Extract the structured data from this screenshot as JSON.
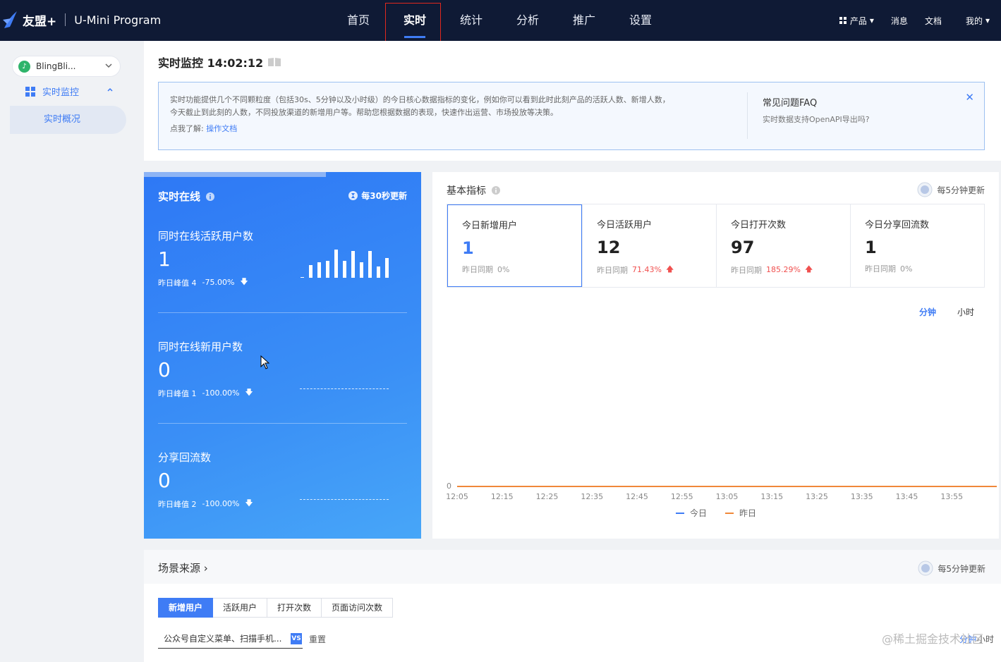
{
  "header": {
    "brand": "友盟+",
    "product": "U-Mini Program",
    "nav": [
      "首页",
      "实时",
      "统计",
      "分析",
      "推广",
      "设置"
    ],
    "active_nav": "实时",
    "right_products": "产品",
    "right_messages": "消息",
    "right_docs": "文档",
    "right_mine": "我的"
  },
  "sidebar": {
    "app_name": "BlingBli...",
    "menu_group": "实时监控",
    "menu_item": "实时概况"
  },
  "page": {
    "title": "实时监控 14:02:12",
    "info_line1": "实时功能提供几个不同颗粒度（包括30s、5分钟以及小时级）的今日核心数据指标的变化，例如你可以看到此时此刻产品的活跃人数、新增人数，",
    "info_line2": "今天截止到此刻的人数，不同投放渠道的新增用户等。帮助您根据数据的表现，快速作出运营、市场投放等决策。",
    "info_learn": "点我了解:",
    "info_link": "操作文档",
    "faq_title": "常见问题FAQ",
    "faq_question": "实时数据支持OpenAPI导出吗?"
  },
  "realtime": {
    "title": "实时在线",
    "update": "每30秒更新",
    "sections": [
      {
        "label": "同时在线活跃用户数",
        "value": "1",
        "peak": "昨日峰值 4",
        "change": "-75.00%"
      },
      {
        "label": "同时在线新用户数",
        "value": "0",
        "peak": "昨日峰值 1",
        "change": "-100.00%"
      },
      {
        "label": "分享回流数",
        "value": "0",
        "peak": "昨日峰值 2",
        "change": "-100.00%"
      }
    ],
    "sparkline": [
      0,
      0.45,
      0.55,
      0.6,
      1.0,
      0.6,
      0.95,
      0.55,
      0.95,
      0.4,
      0.7
    ]
  },
  "metrics": {
    "title": "基本指标",
    "update": "每5分钟更新",
    "cards": [
      {
        "label": "今日新增用户",
        "value": "1",
        "cmp": "昨日同期",
        "change": "0%",
        "trend": "flat"
      },
      {
        "label": "今日活跃用户",
        "value": "12",
        "cmp": "昨日同期",
        "change": "71.43%",
        "trend": "up"
      },
      {
        "label": "今日打开次数",
        "value": "97",
        "cmp": "昨日同期",
        "change": "185.29%",
        "trend": "up"
      },
      {
        "label": "今日分享回流数",
        "value": "1",
        "cmp": "昨日同期",
        "change": "0%",
        "trend": "flat"
      }
    ],
    "toggle_minute": "分钟",
    "toggle_hour": "小时",
    "legend_today": "今日",
    "legend_yesterday": "昨日",
    "colors": {
      "today": "#3f7cf5",
      "yesterday": "#f0883a"
    }
  },
  "chart_data": {
    "type": "line",
    "x": [
      "12:05",
      "12:15",
      "12:25",
      "12:35",
      "12:45",
      "12:55",
      "13:05",
      "13:15",
      "13:25",
      "13:35",
      "13:45",
      "13:55"
    ],
    "y_ticks": [
      "0"
    ],
    "series": [
      {
        "name": "今日",
        "values": [
          0,
          0,
          0,
          0,
          0,
          0,
          0,
          0,
          0,
          0,
          0,
          0
        ]
      },
      {
        "name": "昨日",
        "values": [
          0,
          0,
          0,
          0,
          0,
          0,
          0,
          0,
          0,
          0,
          0,
          0
        ]
      }
    ]
  },
  "scene": {
    "title": "场景来源",
    "update": "每5分钟更新",
    "tabs": [
      "新增用户",
      "活跃用户",
      "打开次数",
      "页面访问次数"
    ],
    "active_tab": "新增用户",
    "filter_value": "公众号自定义菜单、扫描手机...",
    "reset": "重置",
    "watermark": "@稀土掘金技术社区",
    "wm_minute": "分钟",
    "wm_hour": "小时"
  }
}
